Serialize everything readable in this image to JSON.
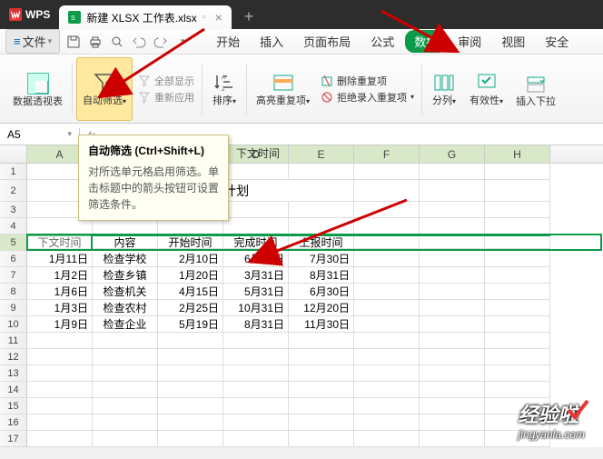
{
  "titlebar": {
    "logo": "WPS",
    "tab_name": "新建 XLSX 工作表.xlsx"
  },
  "menubar": {
    "file": "文件",
    "tabs": [
      "开始",
      "插入",
      "页面布局",
      "公式",
      "数据",
      "审阅",
      "视图",
      "安全"
    ],
    "active_index": 4
  },
  "ribbon": {
    "pivot": "数据透视表",
    "autofilter": "自动筛选",
    "showall": "全部显示",
    "reapply": "重新应用",
    "sort": "排序",
    "highlight_dup": "高亮重复项",
    "delete_dup": "删除重复项",
    "reject_dup": "拒绝录入重复项",
    "split": "分列",
    "validity": "有效性",
    "dropdown": "插入下拉"
  },
  "tooltip": {
    "title": "自动筛选 (Ctrl+Shift+L)",
    "body": "对所选单元格启用筛选。单击标题中的箭头按钮可设置筛选条件。"
  },
  "name_box": "A5",
  "formula_bar": "下文时间",
  "columns": [
    "A",
    "B",
    "C",
    "D",
    "E",
    "F",
    "G",
    "H"
  ],
  "sheet": {
    "title": "2019年安全检查计划",
    "headers": [
      "下文时间",
      "内容",
      "开始时间",
      "完成时间",
      "上报时间"
    ],
    "rows": [
      [
        "1月11日",
        "检查学校",
        "2月10日",
        "6月30日",
        "7月30日"
      ],
      [
        "1月2日",
        "检查乡镇",
        "1月20日",
        "3月31日",
        "8月31日"
      ],
      [
        "1月6日",
        "检查机关",
        "4月15日",
        "5月31日",
        "6月30日"
      ],
      [
        "1月3日",
        "检查农村",
        "2月25日",
        "10月31日",
        "12月20日"
      ],
      [
        "1月9日",
        "检查企业",
        "5月19日",
        "8月31日",
        "11月30日"
      ]
    ]
  },
  "watermark": {
    "text": "经验啦",
    "url": "jingyanla.com"
  }
}
